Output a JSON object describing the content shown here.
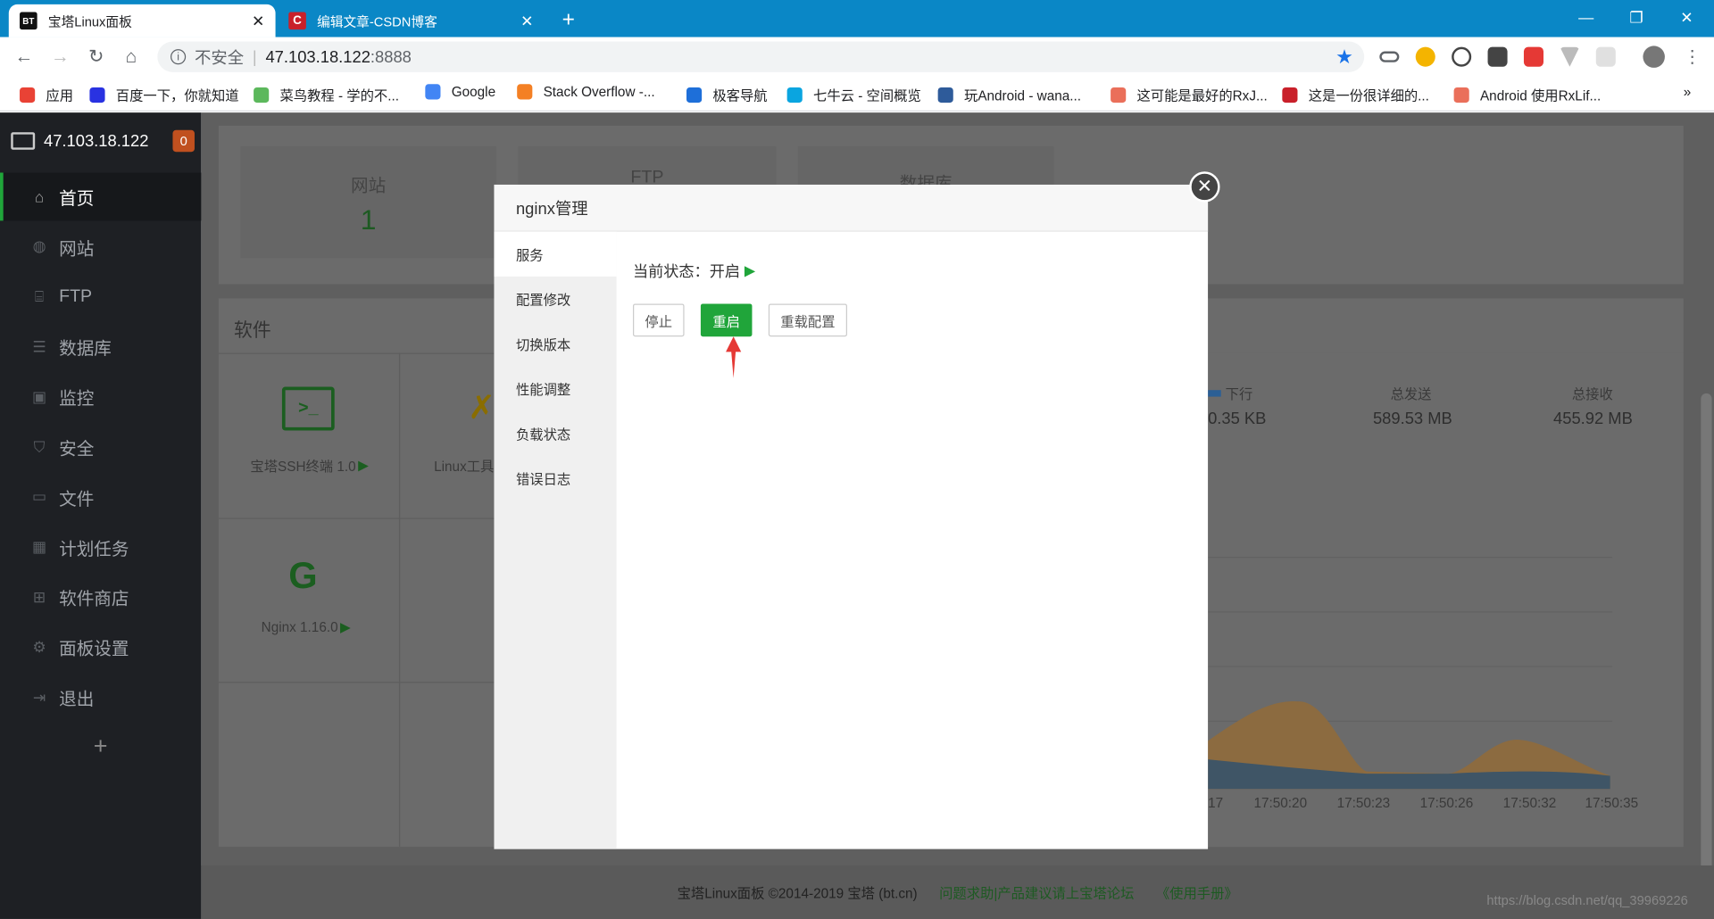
{
  "browser": {
    "tabs": [
      {
        "title": "宝塔Linux面板",
        "favicon": "BT"
      },
      {
        "title": "编辑文章-CSDN博客",
        "favicon": "C"
      }
    ],
    "new_tab": "+",
    "security_label": "不安全",
    "url_host": "47.103.18.122",
    "url_port": ":8888",
    "bookmarks": [
      {
        "label": "应用",
        "icon": "apps-icon",
        "color": "#e94235"
      },
      {
        "label": "百度一下，你就知道",
        "icon": "baidu-icon",
        "color": "#2932e1"
      },
      {
        "label": "菜鸟教程 - 学的不...",
        "icon": "runoob-icon",
        "color": "#5cb85c"
      },
      {
        "label": "Google",
        "icon": "google-icon",
        "color": "#4285f4"
      },
      {
        "label": "Stack Overflow -...",
        "icon": "stackoverflow-icon",
        "color": "#f48024"
      },
      {
        "label": "极客导航",
        "icon": "jike-icon",
        "color": "#1e6fd9"
      },
      {
        "label": "七牛云 - 空间概览",
        "icon": "qiniu-icon",
        "color": "#0aa5e0"
      },
      {
        "label": "玩Android - wana...",
        "icon": "wanandroid-icon",
        "color": "#2e5b9a"
      },
      {
        "label": "这可能是最好的RxJ...",
        "icon": "jianshu-icon",
        "color": "#ea6f5a"
      },
      {
        "label": "这是一份很详细的...",
        "icon": "csdn-icon",
        "color": "#c9202a"
      },
      {
        "label": "Android 使用RxLif...",
        "icon": "jianshu-icon",
        "color": "#ea6f5a"
      }
    ],
    "more_bookmarks": "»"
  },
  "sidebar": {
    "server_ip": "47.103.18.122",
    "badge": "0",
    "items": [
      {
        "label": "首页",
        "icon": "home-icon"
      },
      {
        "label": "网站",
        "icon": "globe-icon"
      },
      {
        "label": "FTP",
        "icon": "ftp-icon"
      },
      {
        "label": "数据库",
        "icon": "database-icon"
      },
      {
        "label": "监控",
        "icon": "monitor-icon"
      },
      {
        "label": "安全",
        "icon": "shield-icon"
      },
      {
        "label": "文件",
        "icon": "folder-icon"
      },
      {
        "label": "计划任务",
        "icon": "calendar-icon"
      },
      {
        "label": "软件商店",
        "icon": "grid-icon"
      },
      {
        "label": "面板设置",
        "icon": "gear-icon"
      },
      {
        "label": "退出",
        "icon": "logout-icon"
      }
    ],
    "add": "+"
  },
  "dashboard": {
    "stats": [
      {
        "label": "网站",
        "value": "1"
      },
      {
        "label": "FTP",
        "value": ""
      },
      {
        "label": "数据库",
        "value": ""
      }
    ],
    "software_title": "软件",
    "software": [
      {
        "label": "宝塔SSH终端 1.0"
      },
      {
        "label": "Linux工具"
      },
      {
        "label": "Nginx 1.16.0"
      }
    ],
    "traffic": {
      "down_label": "下行",
      "down_value": "0.35 KB",
      "sent_label": "总发送",
      "sent_value": "589.53 MB",
      "recv_label": "总接收",
      "recv_value": "455.92 MB",
      "time_ticks": [
        "17",
        "17:50:20",
        "17:50:23",
        "17:50:26",
        "17:50:32",
        "17:50:35"
      ]
    },
    "footer": {
      "copyright": "宝塔Linux面板 ©2014-2019 宝塔 (bt.cn)",
      "forum": "问题求助|产品建议请上宝塔论坛",
      "manual": "《使用手册》",
      "watermark": "https://blog.csdn.net/qq_39969226"
    }
  },
  "modal": {
    "title": "nginx管理",
    "menu": [
      "服务",
      "配置修改",
      "切换版本",
      "性能调整",
      "负载状态",
      "错误日志"
    ],
    "status_label": "当前状态：",
    "status_value": "开启",
    "buttons": {
      "stop": "停止",
      "restart": "重启",
      "reload": "重载配置"
    },
    "accent": "#20a53a"
  }
}
